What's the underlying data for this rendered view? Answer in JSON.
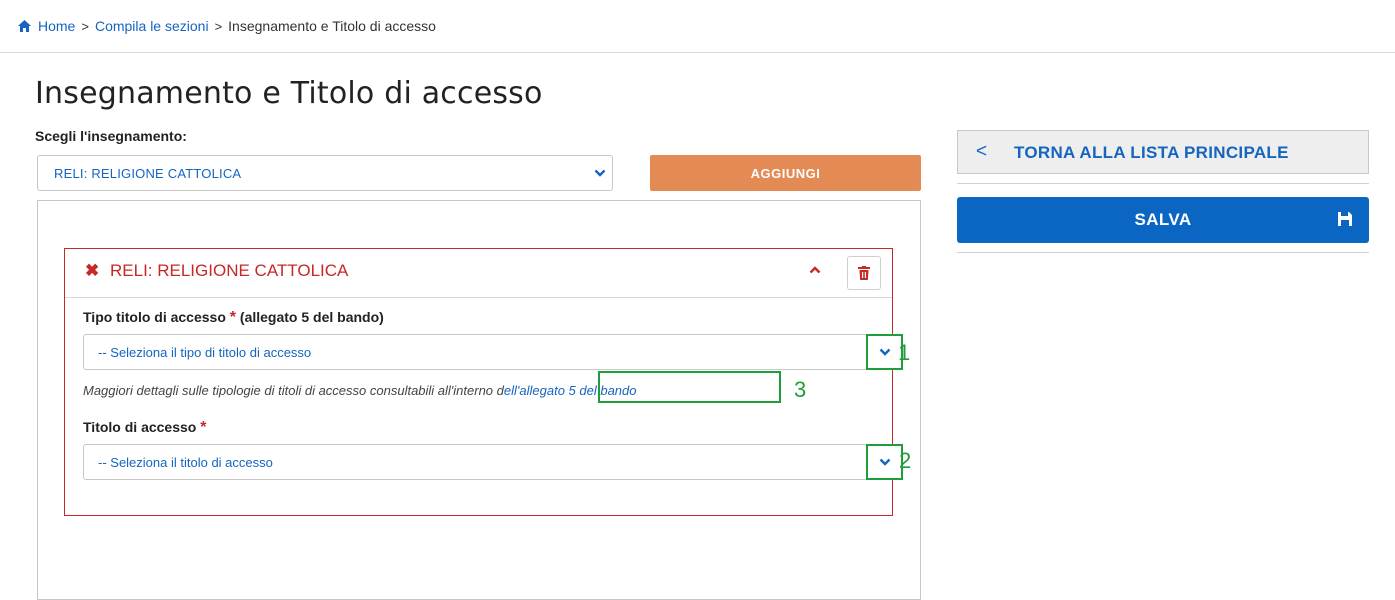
{
  "breadcrumb": {
    "home": "Home",
    "sep": ">",
    "step": "Compila le sezioni",
    "current": "Insegnamento e Titolo di accesso"
  },
  "page": {
    "title": "Insegnamento e Titolo di accesso",
    "choose_label": "Scegli l'insegnamento:",
    "selected_teaching": "RELI: RELIGIONE CATTOLICA",
    "add_button": "AGGIUNGI"
  },
  "card": {
    "title": "RELI: RELIGIONE CATTOLICA",
    "tipo_label": "Tipo titolo di accesso",
    "tipo_suffix": " (allegato 5 del bando)",
    "required_mark": "*",
    "tipo_placeholder": "-- Seleziona il tipo di titolo di accesso",
    "hint_text": "Maggiori dettagli sulle tipologie di titoli di accesso consultabili all'interno d",
    "hint_link_prefix": "ell'",
    "hint_link": "allegato 5 del bando",
    "titolo_label": "Titolo di accesso",
    "titolo_placeholder": "-- Seleziona il titolo di accesso"
  },
  "annotations": {
    "one": "1",
    "two": "2",
    "three": "3"
  },
  "sidebar": {
    "back_icon": "<",
    "back_label": "TORNA ALLA LISTA PRINCIPALE",
    "save_label": "SALVA"
  },
  "colors": {
    "link": "#1565c0",
    "danger": "#c62828",
    "accent_orange": "#e38a55",
    "primary": "#0b66c3",
    "annotation_green": "#1e9e3a"
  }
}
